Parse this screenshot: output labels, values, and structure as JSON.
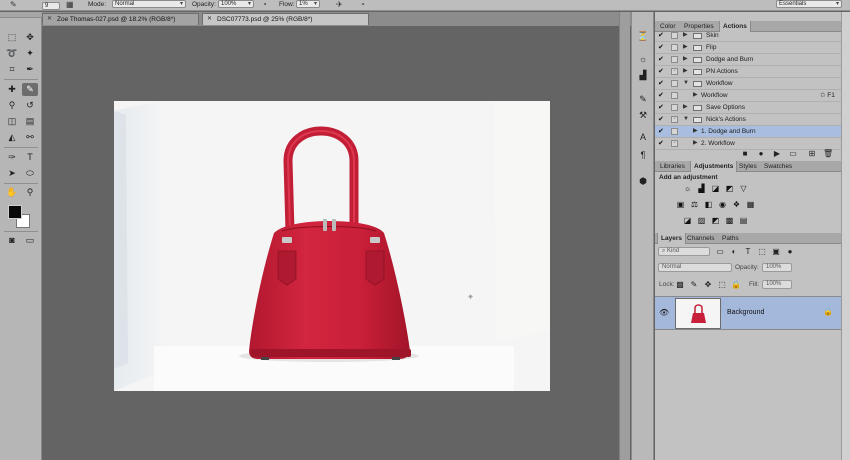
{
  "options_bar": {
    "brush_size": "9",
    "mode_label": "Mode:",
    "mode_value": "Normal",
    "opacity_label": "Opacity:",
    "opacity_value": "100%",
    "flow_label": "Flow:",
    "flow_value": "1%",
    "workspace": "Essentials"
  },
  "tabs": [
    {
      "label": "Zoe Thomas-027.psd @ 18.2% (RGB/8*)"
    },
    {
      "label": "DSC07773.psd @ 25% (RGB/8*)"
    }
  ],
  "panels": {
    "top_tabs": [
      "Color",
      "Properties",
      "Actions"
    ],
    "actions": [
      {
        "label": "Skin",
        "type": "set",
        "check": true
      },
      {
        "label": "Flip",
        "type": "set",
        "check": true
      },
      {
        "label": "Dodge and Burn",
        "type": "set",
        "check": true
      },
      {
        "label": "PN Actions",
        "type": "set",
        "check": true
      },
      {
        "label": "Workflow",
        "type": "set-open",
        "check": true
      },
      {
        "label": "Workflow",
        "type": "action",
        "check": true,
        "shortcut": "F1"
      },
      {
        "label": "Save Options",
        "type": "set",
        "check": true
      },
      {
        "label": "Nick's Actions",
        "type": "set-open",
        "check": true
      },
      {
        "label": "1. Dodge and Burn",
        "type": "action",
        "check": true,
        "selected": true
      },
      {
        "label": "2. Workflow",
        "type": "action",
        "check": true
      }
    ],
    "mid_tabs": [
      "Libraries",
      "Adjustments",
      "Styles",
      "Swatches"
    ],
    "add_adjustment": "Add an adjustment",
    "layer_tabs": [
      "Layers",
      "Channels",
      "Paths"
    ],
    "kind_label": "Kind",
    "blend_mode": "Normal",
    "opacity_label": "Opacity:",
    "opacity_value": "100%",
    "lock_label": "Lock:",
    "fill_label": "Fill:",
    "fill_value": "100%",
    "layer_name": "Background"
  },
  "colors": {
    "bag": "#c8203a",
    "selection": "#a4b8dc"
  }
}
